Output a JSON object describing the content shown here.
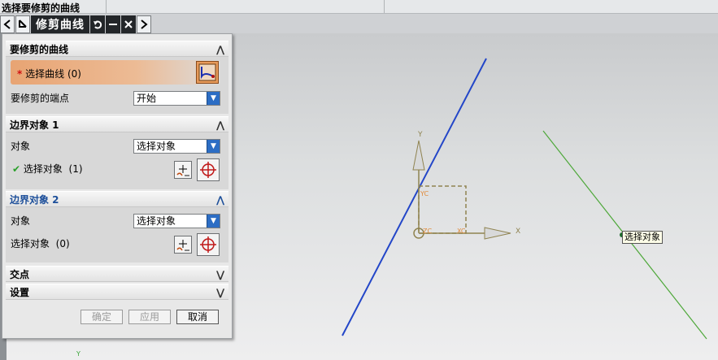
{
  "status": {
    "text": "选择要修剪的曲线"
  },
  "toolbar": {
    "title": "修剪曲线",
    "back_icon": "chevron-left-icon",
    "select_icon": "pointer-arrow-icon",
    "undo_icon": "undo-icon",
    "minimize_icon": "minimize-icon",
    "close_icon": "close-icon",
    "forward_icon": "chevron-right-icon"
  },
  "sections": {
    "curve": {
      "title": "要修剪的曲线",
      "select_label": "选择曲线",
      "select_count": "(0)",
      "required_mark": "*",
      "endpoint_label": "要修剪的端点",
      "endpoint_value": "开始"
    },
    "boundary1": {
      "title": "边界对象 1",
      "object_label": "对象",
      "object_value": "选择对象",
      "select_label": "选择对象",
      "select_count": "(1)"
    },
    "boundary2": {
      "title": "边界对象 2",
      "object_label": "对象",
      "object_value": "选择对象",
      "select_label": "选择对象",
      "select_count": "(0)"
    },
    "intersection": {
      "title": "交点"
    },
    "settings": {
      "title": "设置"
    }
  },
  "footer": {
    "ok": "确定",
    "apply": "应用",
    "cancel": "取消"
  },
  "viewport": {
    "tooltip": "选择对象",
    "axis_x": "X",
    "axis_y": "Y",
    "axis_xc": "XC",
    "axis_yc": "YC",
    "axis_zc": "ZC",
    "small_y": "Y"
  },
  "colors": {
    "accent": "#1d4f9a",
    "blue_line": "#2346c8",
    "green_line": "#4ea83a",
    "wcs": "#8f8350"
  }
}
